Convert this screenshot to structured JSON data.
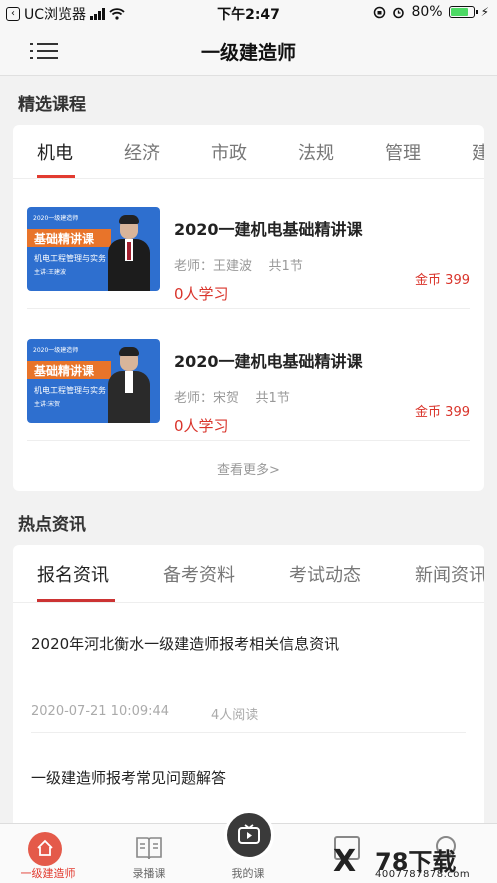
{
  "status": {
    "carrier": "UC浏览器",
    "time": "下午2:47",
    "battery": "80%"
  },
  "nav": {
    "title": "一级建造师"
  },
  "featured": {
    "section_title": "精选课程",
    "tabs": [
      "机电",
      "经济",
      "市政",
      "法规",
      "管理",
      "建"
    ],
    "courses": [
      {
        "title": "2020一建机电基础精讲课",
        "teacher": "老师：王建波",
        "lessons": "共1节",
        "learners": "0人学习",
        "price": "金币 399",
        "thumb": {
          "tag": "2020一级建造师",
          "badge": "基础精讲课",
          "subtitle": "机电工程管理与实务",
          "lecturer": "主讲:王建波"
        }
      },
      {
        "title": "2020一建机电基础精讲课",
        "teacher": "老师：宋贺",
        "lessons": "共1节",
        "learners": "0人学习",
        "price": "金币 399",
        "thumb": {
          "tag": "2020一级建造师",
          "badge": "基础精讲课",
          "subtitle": "机电工程管理与实务",
          "lecturer": "主讲:宋贺"
        }
      }
    ],
    "more": "查看更多>"
  },
  "hot": {
    "section_title": "热点资讯",
    "tabs": [
      "报名资讯",
      "备考资料",
      "考试动态",
      "新闻资讯"
    ],
    "items": [
      {
        "title": "2020年河北衡水一级建造师报考相关信息资讯",
        "date": "2020-07-21 10:09:44",
        "reads": "4人阅读"
      },
      {
        "title": "一级建造师报考常见问题解答"
      }
    ]
  },
  "tabbar": {
    "items": [
      "一级建造师",
      "录播课",
      "我的课"
    ]
  },
  "watermark": {
    "logo": "X",
    "name": "78下载",
    "url": "4007787878.com"
  },
  "colors": {
    "accent": "#e23b30",
    "thumb_blue": "#2e6fcf",
    "thumb_orange": "#e8742a"
  }
}
